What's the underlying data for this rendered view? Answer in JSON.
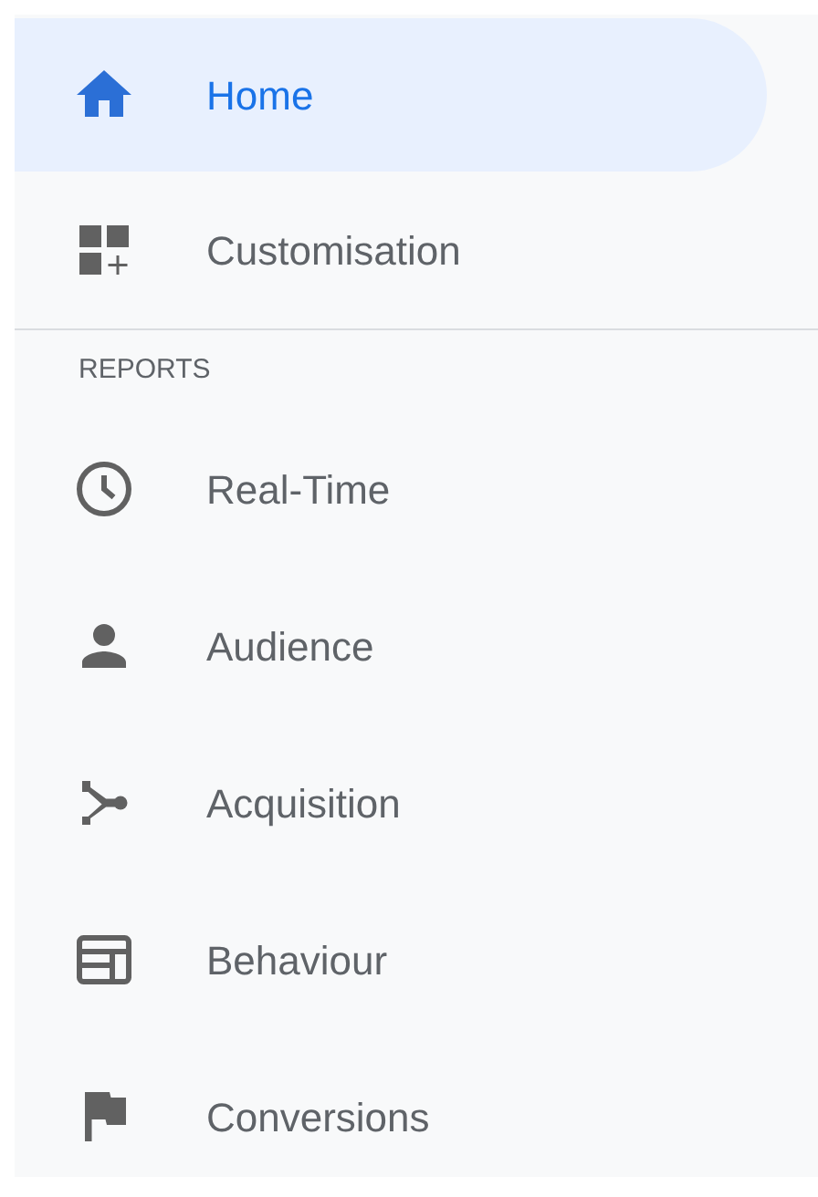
{
  "nav": {
    "items": [
      {
        "label": "Home",
        "selected": true
      },
      {
        "label": "Customisation",
        "selected": false
      }
    ]
  },
  "reports": {
    "heading": "REPORTS",
    "items": [
      {
        "label": "Real-Time",
        "selected": false
      },
      {
        "label": "Audience",
        "selected": false
      },
      {
        "label": "Acquisition",
        "selected": false
      },
      {
        "label": "Behaviour",
        "selected": false
      },
      {
        "label": "Conversions",
        "selected": false
      }
    ]
  }
}
